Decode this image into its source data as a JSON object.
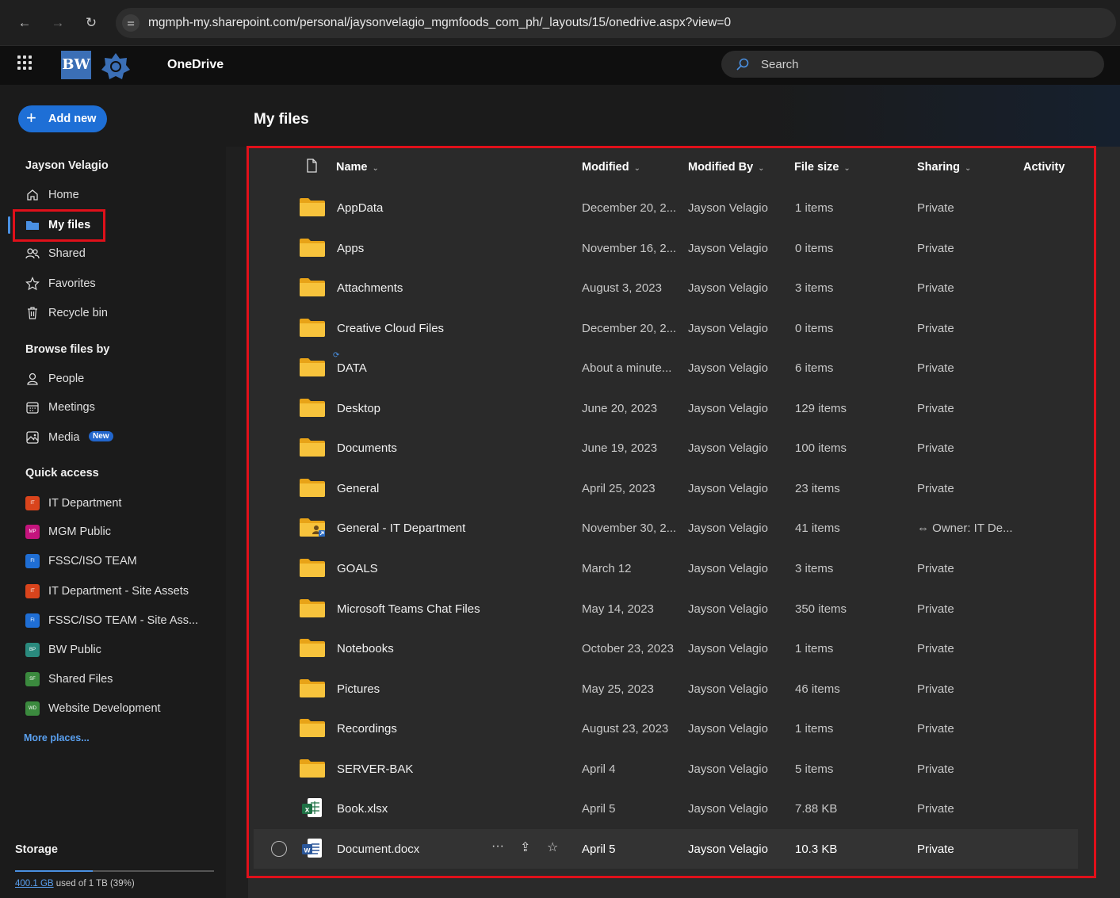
{
  "browser": {
    "url": "mgmph-my.sharepoint.com/personal/jaysonvelagio_mgmfoods_com_ph/_layouts/15/onedrive.aspx?view=0"
  },
  "header": {
    "logo_text": "BW",
    "app_name": "OneDrive",
    "search_placeholder": "Search"
  },
  "sidebar": {
    "add_new": "Add new",
    "user_name": "Jayson Velagio",
    "nav": [
      {
        "label": "Home",
        "icon": "home-icon"
      },
      {
        "label": "My files",
        "icon": "folder-icon",
        "active": true
      },
      {
        "label": "Shared",
        "icon": "people-icon"
      },
      {
        "label": "Favorites",
        "icon": "star-icon"
      },
      {
        "label": "Recycle bin",
        "icon": "trash-icon"
      }
    ],
    "browse_heading": "Browse files by",
    "browse": [
      {
        "label": "People",
        "icon": "person-icon"
      },
      {
        "label": "Meetings",
        "icon": "calendar-icon"
      },
      {
        "label": "Media",
        "icon": "image-icon",
        "badge": "New"
      }
    ],
    "quick_heading": "Quick access",
    "quick": [
      {
        "label": "IT Department",
        "abbr": "IT",
        "color": "#d9441c"
      },
      {
        "label": "MGM Public",
        "abbr": "MP",
        "color": "#c4147d"
      },
      {
        "label": "FSSC/ISO TEAM",
        "abbr": "FI",
        "color": "#1f6ed4"
      },
      {
        "label": "IT Department - Site Assets",
        "abbr": "IT",
        "color": "#d9441c"
      },
      {
        "label": "FSSC/ISO TEAM - Site Ass...",
        "abbr": "FI",
        "color": "#1f6ed4"
      },
      {
        "label": "BW Public",
        "abbr": "BP",
        "color": "#2a8a7e"
      },
      {
        "label": "Shared Files",
        "abbr": "SF",
        "color": "#3b8a3e"
      },
      {
        "label": "Website Development",
        "abbr": "WD",
        "color": "#3b8a3e"
      }
    ],
    "more_places": "More places...",
    "storage_label": "Storage",
    "storage_used": "400.1 GB",
    "storage_rest": " used of 1 TB (39%)",
    "storage_fraction": 0.39
  },
  "main": {
    "title": "My files",
    "columns": {
      "name": "Name",
      "modified": "Modified",
      "modified_by": "Modified By",
      "file_size": "File size",
      "sharing": "Sharing",
      "activity": "Activity"
    },
    "rows": [
      {
        "name": "AppData",
        "modified": "December 20, 2...",
        "modified_by": "Jayson Velagio",
        "size": "1 items",
        "sharing": "Private",
        "type": "folder"
      },
      {
        "name": "Apps",
        "modified": "November 16, 2...",
        "modified_by": "Jayson Velagio",
        "size": "0 items",
        "sharing": "Private",
        "type": "folder"
      },
      {
        "name": "Attachments",
        "modified": "August 3, 2023",
        "modified_by": "Jayson Velagio",
        "size": "3 items",
        "sharing": "Private",
        "type": "folder"
      },
      {
        "name": "Creative Cloud Files",
        "modified": "December 20, 2...",
        "modified_by": "Jayson Velagio",
        "size": "0 items",
        "sharing": "Private",
        "type": "folder"
      },
      {
        "name": "DATA",
        "modified": "About a minute...",
        "modified_by": "Jayson Velagio",
        "size": "6 items",
        "sharing": "Private",
        "type": "folder",
        "syncing": true
      },
      {
        "name": "Desktop",
        "modified": "June 20, 2023",
        "modified_by": "Jayson Velagio",
        "size": "129 items",
        "sharing": "Private",
        "type": "folder"
      },
      {
        "name": "Documents",
        "modified": "June 19, 2023",
        "modified_by": "Jayson Velagio",
        "size": "100 items",
        "sharing": "Private",
        "type": "folder"
      },
      {
        "name": "General",
        "modified": "April 25, 2023",
        "modified_by": "Jayson Velagio",
        "size": "23 items",
        "sharing": "Private",
        "type": "folder"
      },
      {
        "name": "General - IT Department",
        "modified": "November 30, 2...",
        "modified_by": "Jayson Velagio",
        "size": "41 items",
        "sharing": "Owner: IT De...",
        "type": "shared-folder"
      },
      {
        "name": "GOALS",
        "modified": "March 12",
        "modified_by": "Jayson Velagio",
        "size": "3 items",
        "sharing": "Private",
        "type": "folder"
      },
      {
        "name": "Microsoft Teams Chat Files",
        "modified": "May 14, 2023",
        "modified_by": "Jayson Velagio",
        "size": "350 items",
        "sharing": "Private",
        "type": "folder"
      },
      {
        "name": "Notebooks",
        "modified": "October 23, 2023",
        "modified_by": "Jayson Velagio",
        "size": "1 items",
        "sharing": "Private",
        "type": "folder"
      },
      {
        "name": "Pictures",
        "modified": "May 25, 2023",
        "modified_by": "Jayson Velagio",
        "size": "46 items",
        "sharing": "Private",
        "type": "folder"
      },
      {
        "name": "Recordings",
        "modified": "August 23, 2023",
        "modified_by": "Jayson Velagio",
        "size": "1 items",
        "sharing": "Private",
        "type": "folder"
      },
      {
        "name": "SERVER-BAK",
        "modified": "April 4",
        "modified_by": "Jayson Velagio",
        "size": "5 items",
        "sharing": "Private",
        "type": "folder"
      },
      {
        "name": "Book.xlsx",
        "modified": "April 5",
        "modified_by": "Jayson Velagio",
        "size": "7.88 KB",
        "sharing": "Private",
        "type": "excel"
      },
      {
        "name": "Document.docx",
        "modified": "April 5",
        "modified_by": "Jayson Velagio",
        "size": "10.3 KB",
        "sharing": "Private",
        "type": "word",
        "hovered": true
      }
    ]
  },
  "colors": {
    "accent": "#1e6fd6",
    "highlight_box": "#e0101a",
    "folder": "#f5c518"
  }
}
